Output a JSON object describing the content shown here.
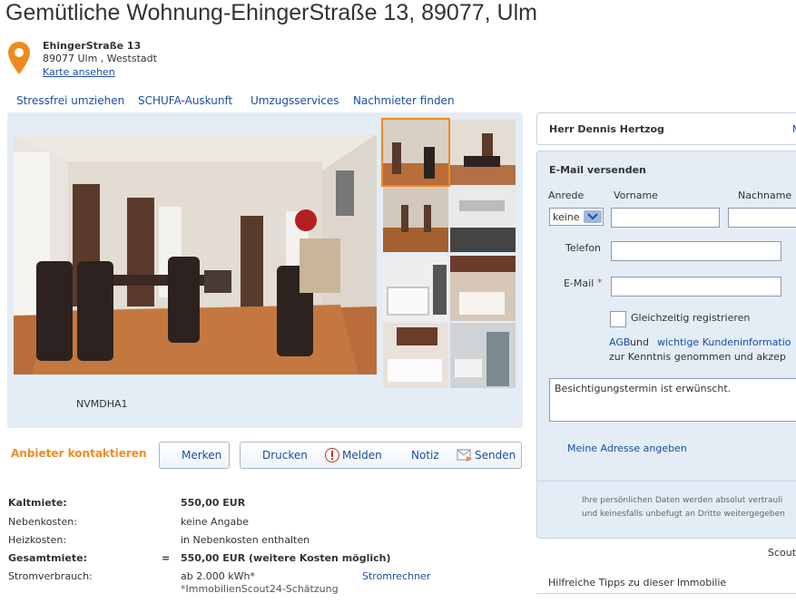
{
  "title": "Gemütliche Wohnung-EhingerStraße 13, 89077, Ulm",
  "address": {
    "street": "EhingerStraße 13",
    "city": "89077 Ulm , Weststadt",
    "map_link": "Karte ansehen"
  },
  "topnav": [
    "Stressfrei umziehen",
    "SCHUFA-Auskunft",
    "Umzugsservices",
    "Nachmieter finden"
  ],
  "gallery": {
    "caption": "NVMDHA1"
  },
  "actions": {
    "contact": "Anbieter kontaktieren",
    "merken": "Merken",
    "drucken": "Drucken",
    "melden": "Melden",
    "notiz": "Notiz",
    "senden": "Senden"
  },
  "costs": [
    {
      "label": "Kaltmiete:",
      "value": "550,00 EUR"
    },
    {
      "label": "Nebenkosten:",
      "value": "keine Angabe"
    },
    {
      "label": "Heizkosten:",
      "value": "in Nebenkosten enthalten"
    },
    {
      "label": "Gesamtmiete:",
      "sign": "=",
      "value": "550,00 EUR (weitere Kosten möglich)"
    },
    {
      "label": "Stromverbrauch:",
      "value": "ab 2.000 kWh*",
      "note": "*ImmobilienScout24-Schätzung",
      "link": "Stromrechner"
    }
  ],
  "contact": {
    "name": "Herr Dennis Hertzog",
    "name_trailing": "M"
  },
  "form": {
    "heading": "E-Mail versenden",
    "anrede_label": "Anrede",
    "anrede_value": "keine",
    "vorname_label": "Vorname",
    "nachname_label": "Nachname",
    "telefon_label": "Telefon",
    "email_label": "E-Mail",
    "required_mark": "*",
    "register_label": "Gleichzeitig registrieren",
    "agb_line1_a": "AGB",
    "agb_line1_b": " und ",
    "agb_line1_c": "wichtige Kundeninformatio",
    "agb_line2": "zur Kenntnis genommen und akzep",
    "message": "Besichtigungstermin ist erwünscht.",
    "address_link": "Meine Adresse angeben",
    "privacy_line1": "Ihre persönlichen Daten werden absolut vertrauli",
    "privacy_line2": "und keinesfalls unbefugt an Dritte weitergegeben"
  },
  "footer_right": {
    "scout": "Scout",
    "tips": "Hilfreiche Tipps zu dieser Immobilie"
  },
  "colors": {
    "accent": "#f08a1f",
    "link": "#1a4fa0",
    "panel": "#e4ecf6"
  }
}
